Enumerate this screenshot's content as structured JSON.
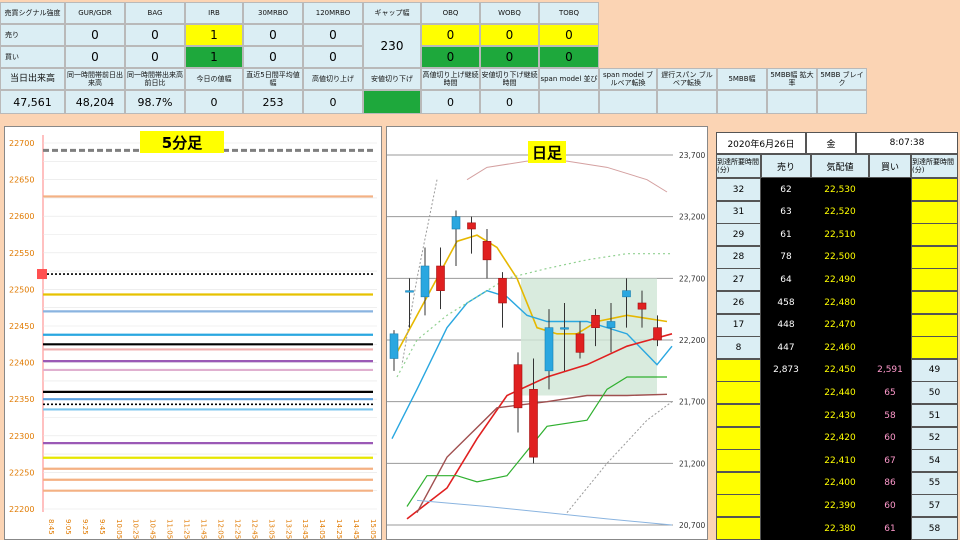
{
  "top": {
    "headers": [
      "売買シグナル強度",
      "GUR/GDR",
      "BAG",
      "IRB",
      "30MRBO",
      "120MRBO",
      "ギャップ幅",
      "OBQ",
      "WOBQ",
      "TOBQ"
    ],
    "rows": [
      {
        "label": "売り",
        "values": [
          "0",
          "0",
          "1",
          "0",
          "0",
          "",
          "0",
          "0",
          "0"
        ]
      },
      {
        "label": "買い",
        "values": [
          "0",
          "0",
          "1",
          "0",
          "0",
          "",
          "0",
          "0",
          "0"
        ]
      }
    ],
    "gap_value": "230",
    "headers2": [
      "当日出来高",
      "同一時間帯前日出来高",
      "同一時間帯出来高前日比",
      "今日の値幅",
      "直近5日間平均値幅",
      "高値切り上げ",
      "安値切り下げ",
      "高値切り上げ継続時間",
      "安値切り下げ継続時間",
      "span model 並び",
      "span model ブルベア転換",
      "遅行スパン ブルベア転換",
      "5MBB幅",
      "5MBB幅 拡大率",
      "5MBB ブレイク"
    ],
    "values2": [
      "47,561",
      "48,204",
      "98.7%",
      "0",
      "253",
      "0",
      "",
      "0",
      "0",
      "",
      "",
      "",
      "",
      "",
      ""
    ],
    "colors": {
      "yellow": "#ffff00",
      "green": "#1ea83c",
      "light": "#dbeef4",
      "orange_bg": "#fbd4b4"
    }
  },
  "chart5": {
    "title": "5分足",
    "yticks": [
      "22700",
      "22650",
      "22600",
      "22550",
      "22500",
      "22450",
      "22400",
      "22350",
      "22300",
      "22250",
      "22200"
    ],
    "xticks": [
      "8:45",
      "9:05",
      "9:25",
      "9:45",
      "10:05",
      "10:25",
      "10:45",
      "11:05",
      "11:25",
      "11:45",
      "12:05",
      "12:25",
      "12:45",
      "13:05",
      "13:25",
      "13:45",
      "14:05",
      "14:25",
      "14:45",
      "15:05"
    ],
    "lines": [
      {
        "price": 22690,
        "color": "#7f7f7f",
        "style": "dashed"
      },
      {
        "price": 22627,
        "color": "#f4b183"
      },
      {
        "price": 22521,
        "color": "#000000",
        "style": "dotted"
      },
      {
        "price": 22493,
        "color": "#e6c200"
      },
      {
        "price": 22470,
        "color": "#8ab4e0"
      },
      {
        "price": 22438,
        "color": "#2aa7e0"
      },
      {
        "price": 22425,
        "color": "#000000"
      },
      {
        "price": 22418,
        "color": "#f0b0b0"
      },
      {
        "price": 22402,
        "color": "#9b59b6"
      },
      {
        "price": 22390,
        "color": "#e0b0d0"
      },
      {
        "price": 22360,
        "color": "#000000"
      },
      {
        "price": 22350,
        "color": "#5aa0e0"
      },
      {
        "price": 22343,
        "color": "#000000",
        "style": "dotted"
      },
      {
        "price": 22336,
        "color": "#7cc6ee"
      },
      {
        "price": 22290,
        "color": "#9b59b6"
      },
      {
        "price": 22270,
        "color": "#e6e600"
      },
      {
        "price": 22255,
        "color": "#f4b183"
      },
      {
        "price": 22240,
        "color": "#f4b183"
      },
      {
        "price": 22225,
        "color": "#f4b183"
      }
    ],
    "marker_price": "22521"
  },
  "chartD": {
    "title": "日足",
    "yticks": [
      "23,700",
      "23,200",
      "22,700",
      "22,200",
      "21,700",
      "21,200",
      "20,700"
    ],
    "candles": [
      {
        "o": 22050,
        "c": 22250,
        "h": 22280,
        "l": 21950
      },
      {
        "o": 22600,
        "c": 22600,
        "h": 22700,
        "l": 22300
      },
      {
        "o": 22550,
        "c": 22800,
        "h": 22950,
        "l": 22400
      },
      {
        "o": 22800,
        "c": 22600,
        "h": 22950,
        "l": 22450
      },
      {
        "o": 23100,
        "c": 23200,
        "h": 23250,
        "l": 22800
      },
      {
        "o": 23150,
        "c": 23100,
        "h": 23200,
        "l": 22900
      },
      {
        "o": 23000,
        "c": 22850,
        "h": 23100,
        "l": 22700
      },
      {
        "o": 22700,
        "c": 22500,
        "h": 22750,
        "l": 22300
      },
      {
        "o": 22000,
        "c": 21650,
        "h": 22100,
        "l": 21450
      },
      {
        "o": 21800,
        "c": 21250,
        "h": 22050,
        "l": 21200
      },
      {
        "o": 21950,
        "c": 22300,
        "h": 22450,
        "l": 21800
      },
      {
        "o": 22300,
        "c": 22300,
        "h": 22500,
        "l": 21950
      },
      {
        "o": 22250,
        "c": 22100,
        "h": 22350,
        "l": 22050
      },
      {
        "o": 22400,
        "c": 22300,
        "h": 22450,
        "l": 22150
      },
      {
        "o": 22300,
        "c": 22350,
        "h": 22500,
        "l": 22100
      },
      {
        "o": 22550,
        "c": 22600,
        "h": 22700,
        "l": 22300
      },
      {
        "o": 22500,
        "c": 22450,
        "h": 22600,
        "l": 22300
      },
      {
        "o": 22300,
        "c": 22200,
        "h": 22400,
        "l": 22150
      }
    ]
  },
  "board": {
    "date": "2020年6月26日",
    "weekday": "金",
    "time": "8:07:38",
    "headers": [
      "到達所要時間(分)",
      "売り",
      "気配値",
      "買い",
      "到達所要時間(分)"
    ],
    "rows": [
      {
        "left": "32",
        "sell": "62",
        "price": "22,530",
        "buy": "",
        "right": ""
      },
      {
        "left": "31",
        "sell": "63",
        "price": "22,520",
        "buy": "",
        "right": ""
      },
      {
        "left": "29",
        "sell": "61",
        "price": "22,510",
        "buy": "",
        "right": ""
      },
      {
        "left": "28",
        "sell": "78",
        "price": "22,500",
        "buy": "",
        "right": ""
      },
      {
        "left": "27",
        "sell": "64",
        "price": "22,490",
        "buy": "",
        "right": ""
      },
      {
        "left": "26",
        "sell": "458",
        "price": "22,480",
        "buy": "",
        "right": ""
      },
      {
        "left": "17",
        "sell": "448",
        "price": "22,470",
        "buy": "",
        "right": ""
      },
      {
        "left": "8",
        "sell": "447",
        "price": "22,460",
        "buy": "",
        "right": ""
      },
      {
        "left": "",
        "sell": "2,873",
        "price": "22,450",
        "buy": "2,591",
        "right": "49"
      },
      {
        "left": "",
        "sell": "",
        "price": "22,440",
        "buy": "65",
        "right": "50"
      },
      {
        "left": "",
        "sell": "",
        "price": "22,430",
        "buy": "58",
        "right": "51"
      },
      {
        "left": "",
        "sell": "",
        "price": "22,420",
        "buy": "60",
        "right": "52"
      },
      {
        "left": "",
        "sell": "",
        "price": "22,410",
        "buy": "67",
        "right": "54"
      },
      {
        "left": "",
        "sell": "",
        "price": "22,400",
        "buy": "86",
        "right": "55"
      },
      {
        "left": "",
        "sell": "",
        "price": "22,390",
        "buy": "60",
        "right": "57"
      },
      {
        "left": "",
        "sell": "",
        "price": "22,380",
        "buy": "61",
        "right": "58"
      }
    ]
  }
}
